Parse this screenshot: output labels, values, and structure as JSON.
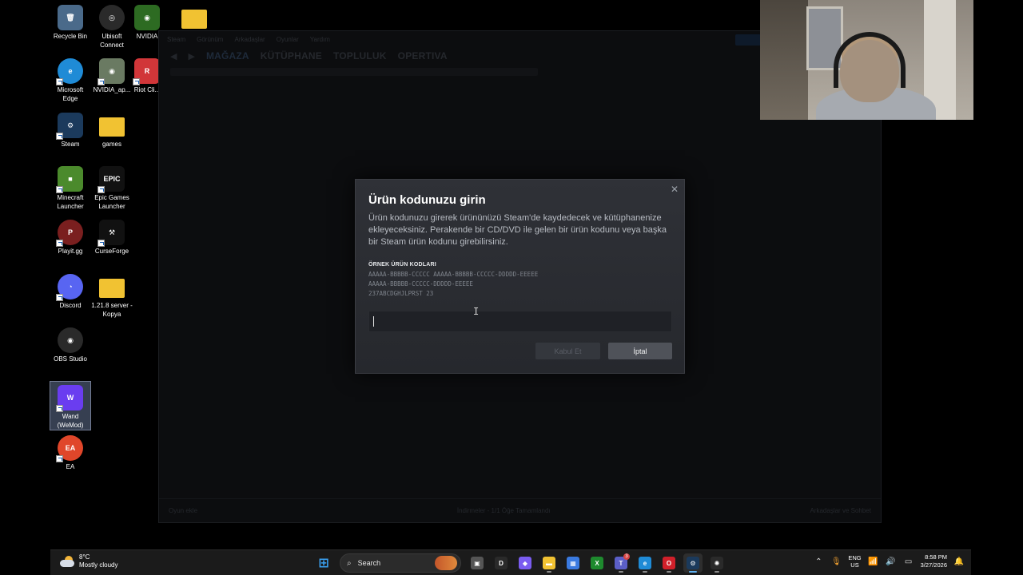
{
  "desktop": {
    "icons": [
      {
        "label": "Recycle Bin",
        "icon": "recycle-bin-icon",
        "color": "#4a6a8a"
      },
      {
        "label": "Ubisoft Connect",
        "icon": "ubisoft-icon",
        "color": "#2a2a2a"
      },
      {
        "label": "NVIDIA",
        "icon": "nvidia-icon",
        "color": "#2d6b22"
      },
      {
        "label": "",
        "icon": "folder-icon",
        "color": "#f1c232"
      },
      {
        "label": "Microsoft Edge",
        "icon": "edge-icon",
        "color": "#1f8bd6"
      },
      {
        "label": "NVIDIA_ap...",
        "icon": "nvidia-app-icon",
        "color": "#6a7a62"
      },
      {
        "label": "Riot Cli...",
        "icon": "riot-icon",
        "color": "#d13639"
      },
      {
        "label": "Steam",
        "icon": "steam-icon",
        "color": "#1b3a5c"
      },
      {
        "label": "games",
        "icon": "folder-icon",
        "color": "#f1c232"
      },
      {
        "label": "Minecraft Launcher",
        "icon": "minecraft-icon",
        "color": "#4b8a2c"
      },
      {
        "label": "Epic Games Launcher",
        "icon": "epic-games-icon",
        "color": "#111111"
      },
      {
        "label": "Playit.gg",
        "icon": "playit-icon",
        "color": "#7a1f1f"
      },
      {
        "label": "CurseForge",
        "icon": "curseforge-icon",
        "color": "#111111"
      },
      {
        "label": "Discord",
        "icon": "discord-icon",
        "color": "#5865f2"
      },
      {
        "label": "1.21.8 server - Kopya",
        "icon": "folder-icon",
        "color": "#f1c232"
      },
      {
        "label": "OBS Studio",
        "icon": "obs-icon",
        "color": "#2a2a2a"
      },
      {
        "label": "Wand (WeMod)",
        "icon": "wand-icon",
        "color": "#6a3df0"
      },
      {
        "label": "EA",
        "icon": "ea-icon",
        "color": "#e0462a"
      }
    ]
  },
  "steam": {
    "nav_tabs": [
      "MAĞAZA",
      "KÜTÜPHANE",
      "TOPLULUK",
      "OPERTIVA"
    ],
    "menu": [
      "Steam",
      "Görünüm",
      "Arkadaşlar",
      "Oyunlar",
      "Yardım"
    ],
    "footer_left": "Oyun ekle",
    "footer_center": "İndirmeler - 1/1 Öğe Tamamlandı",
    "footer_right": "Arkadaşlar ve Sohbet"
  },
  "dialog": {
    "title": "Ürün kodunuzu girin",
    "description": "Ürün kodunuzu girerek ürününüzü Steam'de kaydedecek ve kütüphanenize ekleyeceksiniz. Perakende bir CD/DVD ile gelen bir ürün kodunu veya başka bir Steam ürün kodunu girebilirsiniz.",
    "examples_heading": "ÖRNEK ÜRÜN KODLARI",
    "examples": [
      "AAAAA-BBBBB-CCCCC AAAAA-BBBBB-CCCCC-DDDDD-EEEEE",
      "AAAAA-BBBBB-CCCCC-DDDDD-EEEEE",
      "237ABCDGHJLPRST 23"
    ],
    "input_value": "",
    "next_label": "Kabul Et",
    "cancel_label": "İptal"
  },
  "taskbar": {
    "weather_temp": "8°C",
    "weather_desc": "Mostly cloudy",
    "search_label": "Search",
    "apps": [
      {
        "icon": "start-icon",
        "color": "#3aa0f0"
      },
      {
        "icon": "task-view-icon",
        "color": "#555555"
      },
      {
        "icon": "dell-icon",
        "color": "#2a2a2a"
      },
      {
        "icon": "copilot-icon",
        "color": "#7a5cf0"
      },
      {
        "icon": "file-explorer-icon",
        "color": "#f1c232"
      },
      {
        "icon": "microsoft-store-icon",
        "color": "#3a7ae0"
      },
      {
        "icon": "xbox-icon",
        "color": "#1e8a2e"
      },
      {
        "icon": "teams-icon",
        "color": "#5b5fc7",
        "badge": "3"
      },
      {
        "icon": "edge-icon",
        "color": "#1f8bd6"
      },
      {
        "icon": "opera-icon",
        "color": "#d1202a"
      },
      {
        "icon": "steam-icon",
        "color": "#1b3a5c"
      },
      {
        "icon": "chatgpt-icon",
        "color": "#2a2a2a"
      }
    ],
    "lang_top": "ENG",
    "lang_bottom": "US",
    "time": "8:58 PM",
    "date": "3/27/2026"
  }
}
